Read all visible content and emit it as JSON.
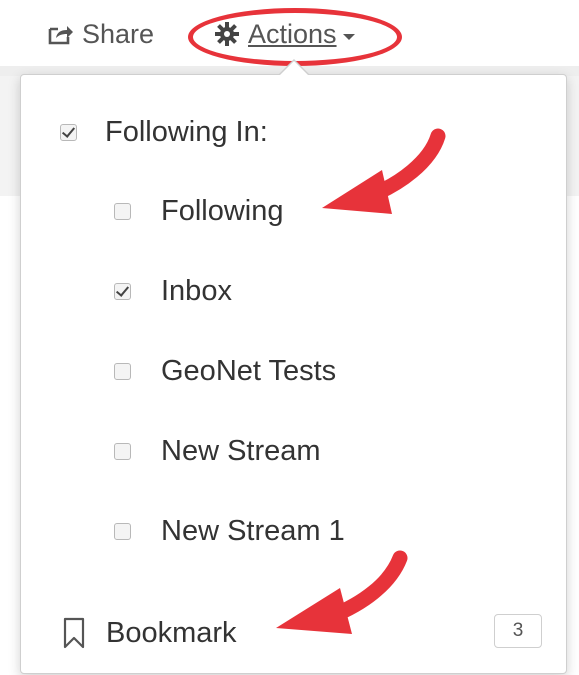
{
  "toolbar": {
    "share_label": "Share",
    "actions_label": "Actions"
  },
  "menu": {
    "following_in_label": "Following In:",
    "following_in_checked": true,
    "streams": [
      {
        "label": "Following",
        "checked": false
      },
      {
        "label": "Inbox",
        "checked": true
      },
      {
        "label": "GeoNet Tests",
        "checked": false
      },
      {
        "label": "New Stream",
        "checked": false
      },
      {
        "label": "New Stream 1",
        "checked": false
      }
    ],
    "bookmark_label": "Bookmark",
    "bookmark_count": "3"
  },
  "icons": {
    "share": "share-icon",
    "actions": "gear-icon",
    "bookmark": "bookmark-icon",
    "caret": "caret-down-icon"
  },
  "colors": {
    "annotation": "#e7333a",
    "text": "#333333"
  }
}
